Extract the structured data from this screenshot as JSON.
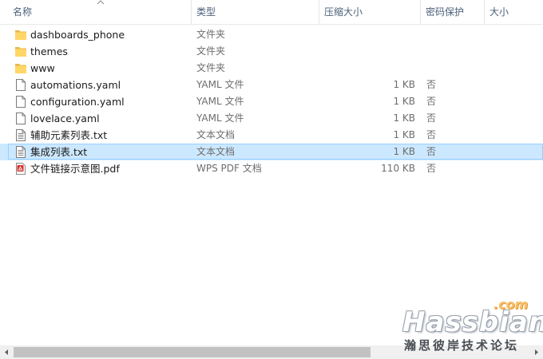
{
  "columns": {
    "name": "名称",
    "type": "类型",
    "compressed_size": "压缩大小",
    "password": "密码保护",
    "size": "大小"
  },
  "files": [
    {
      "name": "dashboards_phone",
      "type": "文件夹",
      "compressed_size": "",
      "password": "",
      "icon": "folder-icon",
      "selected": false
    },
    {
      "name": "themes",
      "type": "文件夹",
      "compressed_size": "",
      "password": "",
      "icon": "folder-icon",
      "selected": false
    },
    {
      "name": "www",
      "type": "文件夹",
      "compressed_size": "",
      "password": "",
      "icon": "folder-icon",
      "selected": false
    },
    {
      "name": "automations.yaml",
      "type": "YAML 文件",
      "compressed_size": "1 KB",
      "password": "否",
      "icon": "blank-file-icon",
      "selected": false
    },
    {
      "name": "configuration.yaml",
      "type": "YAML 文件",
      "compressed_size": "1 KB",
      "password": "否",
      "icon": "blank-file-icon",
      "selected": false
    },
    {
      "name": "lovelace.yaml",
      "type": "YAML 文件",
      "compressed_size": "1 KB",
      "password": "否",
      "icon": "blank-file-icon",
      "selected": false
    },
    {
      "name": "辅助元素列表.txt",
      "type": "文本文档",
      "compressed_size": "1 KB",
      "password": "否",
      "icon": "text-file-icon",
      "selected": false
    },
    {
      "name": "集成列表.txt",
      "type": "文本文档",
      "compressed_size": "1 KB",
      "password": "否",
      "icon": "text-file-icon",
      "selected": true
    },
    {
      "name": "文件链接示意图.pdf",
      "type": "WPS PDF 文档",
      "compressed_size": "110 KB",
      "password": "否",
      "icon": "pdf-file-icon",
      "selected": false
    }
  ],
  "watermark": {
    "domain": ".com",
    "brand": "Hassbian",
    "tagline": "瀚思彼岸技术论坛"
  },
  "colors": {
    "selected_bg": "#cce8ff",
    "selected_border": "#99d1ff",
    "folder": "#ffd766",
    "pdf": "#d9302c"
  }
}
